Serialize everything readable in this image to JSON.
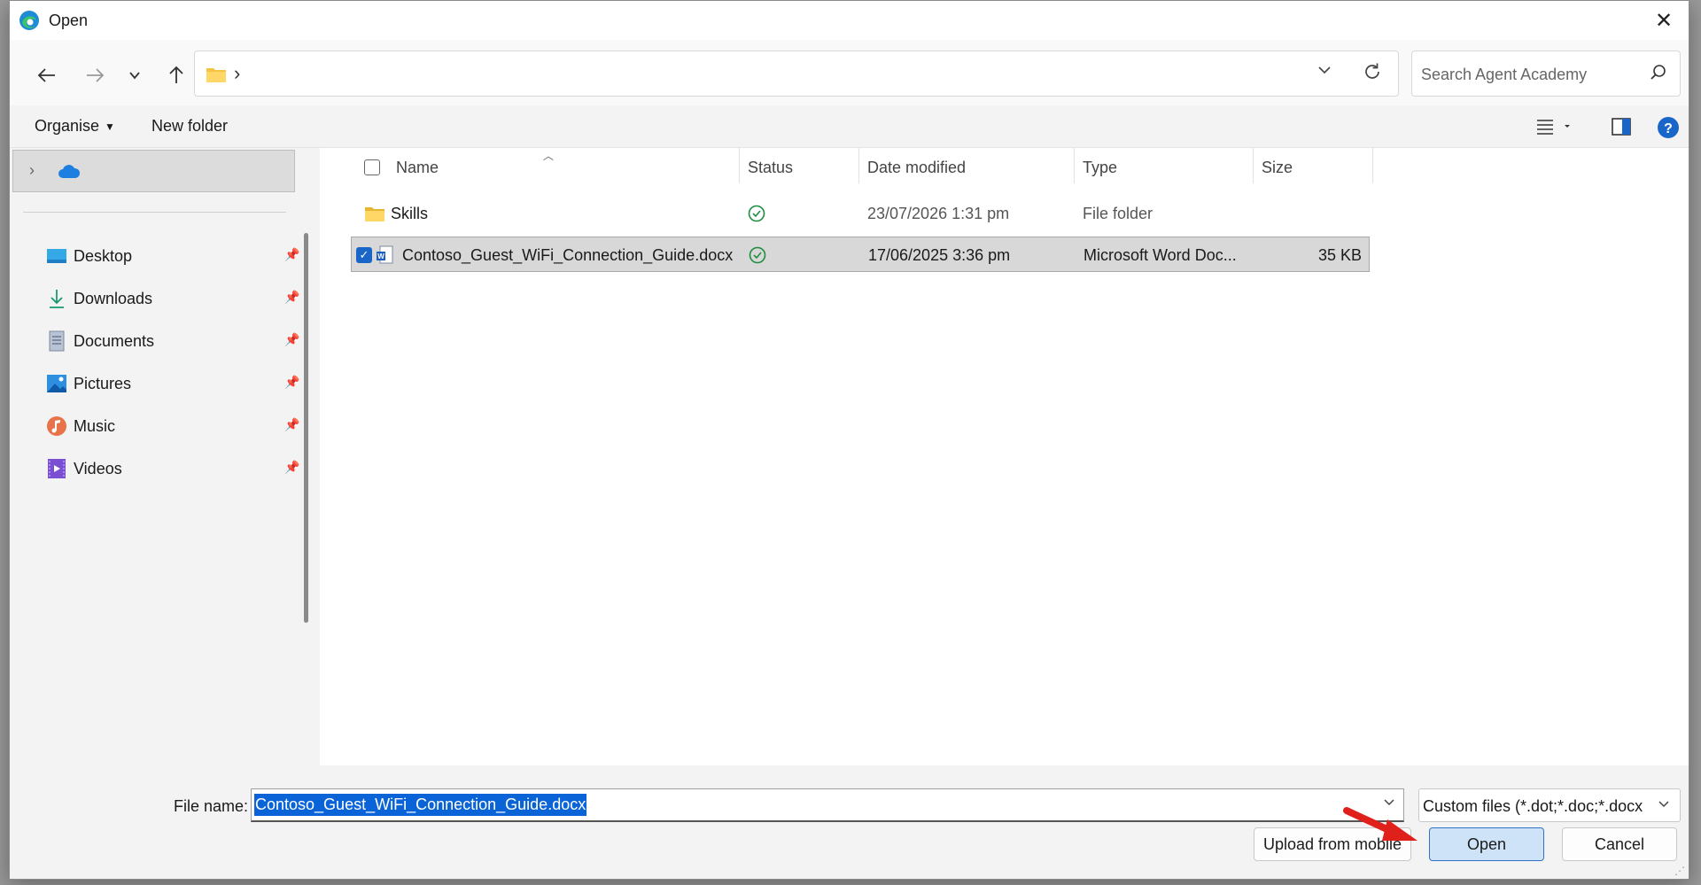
{
  "window": {
    "title": "Open",
    "close_label": "✕"
  },
  "nav": {
    "back_label": "Back",
    "forward_label": "Forward",
    "recent_label": "Recent locations",
    "up_label": "Up",
    "address_separator": "›",
    "search_placeholder": "Search Agent Academy"
  },
  "commands": {
    "organise": "Organise",
    "new_folder": "New folder"
  },
  "sidebar": {
    "items": [
      {
        "label": "Desktop",
        "icon": "desktop-icon"
      },
      {
        "label": "Downloads",
        "icon": "download-icon"
      },
      {
        "label": "Documents",
        "icon": "document-icon"
      },
      {
        "label": "Pictures",
        "icon": "pictures-icon"
      },
      {
        "label": "Music",
        "icon": "music-icon"
      },
      {
        "label": "Videos",
        "icon": "videos-icon"
      }
    ]
  },
  "columns": {
    "name": "Name",
    "status": "Status",
    "date": "Date modified",
    "type": "Type",
    "size": "Size"
  },
  "files": [
    {
      "name": "Skills",
      "status": "synced",
      "date": "23/07/2026 1:31 pm",
      "type": "File folder",
      "size": ""
    },
    {
      "name": "Contoso_Guest_WiFi_Connection_Guide.docx",
      "status": "synced",
      "date": "17/06/2025 3:36 pm",
      "type": "Microsoft Word Doc...",
      "size": "35 KB"
    }
  ],
  "footer": {
    "file_name_label": "File name:",
    "file_name_value": "Contoso_Guest_WiFi_Connection_Guide.docx",
    "filter": "Custom files (*.dot;*.doc;*.docx",
    "upload_button": "Upload from mobile",
    "open_button": "Open",
    "cancel_button": "Cancel"
  },
  "colors": {
    "accent": "#0a64d8",
    "selection": "#d8d8d8",
    "status_ok": "#1e8e3e",
    "annotation_arrow": "#e0201b"
  }
}
